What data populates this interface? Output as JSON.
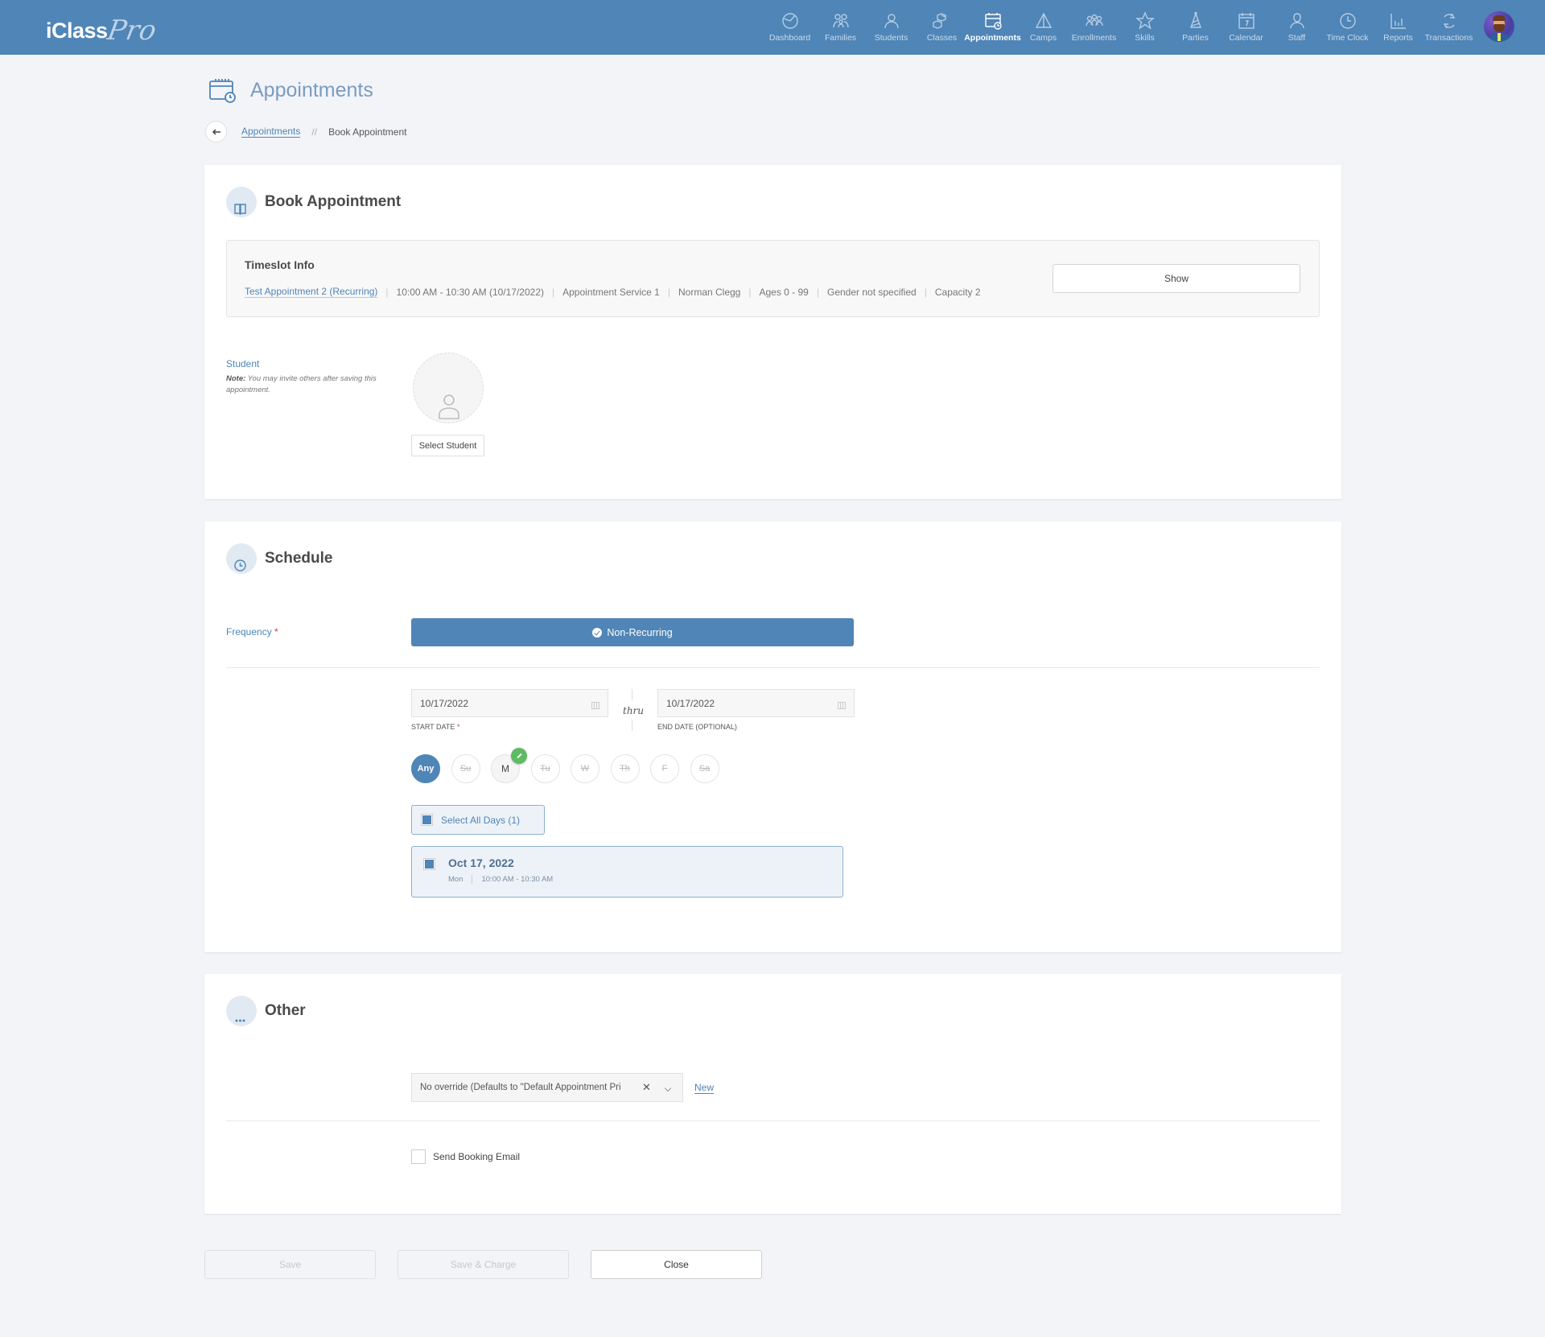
{
  "app": {
    "logo_main": "iClass",
    "logo_script": "Pro"
  },
  "nav": {
    "items": [
      {
        "label": "Dashboard",
        "icon": "dashboard-icon",
        "active": false
      },
      {
        "label": "Families",
        "icon": "families-icon",
        "active": false
      },
      {
        "label": "Students",
        "icon": "students-icon",
        "active": false
      },
      {
        "label": "Classes",
        "icon": "classes-icon",
        "active": false
      },
      {
        "label": "Appointments",
        "icon": "appointments-icon",
        "active": true
      },
      {
        "label": "Camps",
        "icon": "camps-icon",
        "active": false
      },
      {
        "label": "Enrollments",
        "icon": "enrollments-icon",
        "active": false
      },
      {
        "label": "Skills",
        "icon": "star-icon",
        "active": false
      },
      {
        "label": "Parties",
        "icon": "party-hat-icon",
        "active": false
      },
      {
        "label": "Calendar",
        "icon": "calendar-icon",
        "active": false
      },
      {
        "label": "Staff",
        "icon": "staff-icon",
        "active": false
      },
      {
        "label": "Time Clock",
        "icon": "clock-icon",
        "active": false
      },
      {
        "label": "Reports",
        "icon": "bar-chart-icon",
        "active": false
      },
      {
        "label": "Transactions",
        "icon": "refresh-icon",
        "active": false
      }
    ]
  },
  "page": {
    "title": "Appointments",
    "breadcrumb": {
      "parent": "Appointments",
      "separator": "//",
      "current": "Book Appointment"
    }
  },
  "book": {
    "title": "Book Appointment",
    "timeslot": {
      "title": "Timeslot Info",
      "name": "Test Appointment 2 (Recurring)",
      "time": "10:00 AM - 10:30 AM (10/17/2022)",
      "service": "Appointment Service 1",
      "staff": "Norman Clegg",
      "ages": "Ages 0 - 99",
      "gender": "Gender not specified",
      "capacity": "Capacity 2",
      "show_label": "Show"
    },
    "student": {
      "label": "Student",
      "note_bold": "Note:",
      "note_text": " You may invite others after saving this appointment.",
      "select_label": "Select Student"
    }
  },
  "schedule": {
    "title": "Schedule",
    "frequency_label": "Frequency",
    "frequency_value": "Non-Recurring",
    "start_date": "10/17/2022",
    "start_date_label": "START DATE",
    "thru": "thru",
    "end_date": "10/17/2022",
    "end_date_label": "END DATE (OPTIONAL)",
    "days": [
      {
        "label": "Any",
        "state": "any"
      },
      {
        "label": "Su",
        "state": "off"
      },
      {
        "label": "M",
        "state": "on"
      },
      {
        "label": "Tu",
        "state": "off"
      },
      {
        "label": "W",
        "state": "off"
      },
      {
        "label": "Th",
        "state": "off"
      },
      {
        "label": "F",
        "state": "off"
      },
      {
        "label": "Sa",
        "state": "off"
      }
    ],
    "select_all_label": "Select All Days (1)",
    "dates": [
      {
        "date": "Oct 17, 2022",
        "weekday": "Mon",
        "time": "10:00 AM - 10:30 AM",
        "checked": true
      }
    ]
  },
  "other": {
    "title": "Other",
    "price_override_value": "No override (Defaults to \"Default Appointment Pri",
    "new_label": "New",
    "send_email_label": "Send Booking Email",
    "send_email_checked": false
  },
  "actions": {
    "save": "Save",
    "save_charge": "Save & Charge",
    "close": "Close"
  },
  "required_mark": "*",
  "colors": {
    "brand": "#4f85b7",
    "success": "#5dbb63",
    "required": "#d23b3b"
  }
}
